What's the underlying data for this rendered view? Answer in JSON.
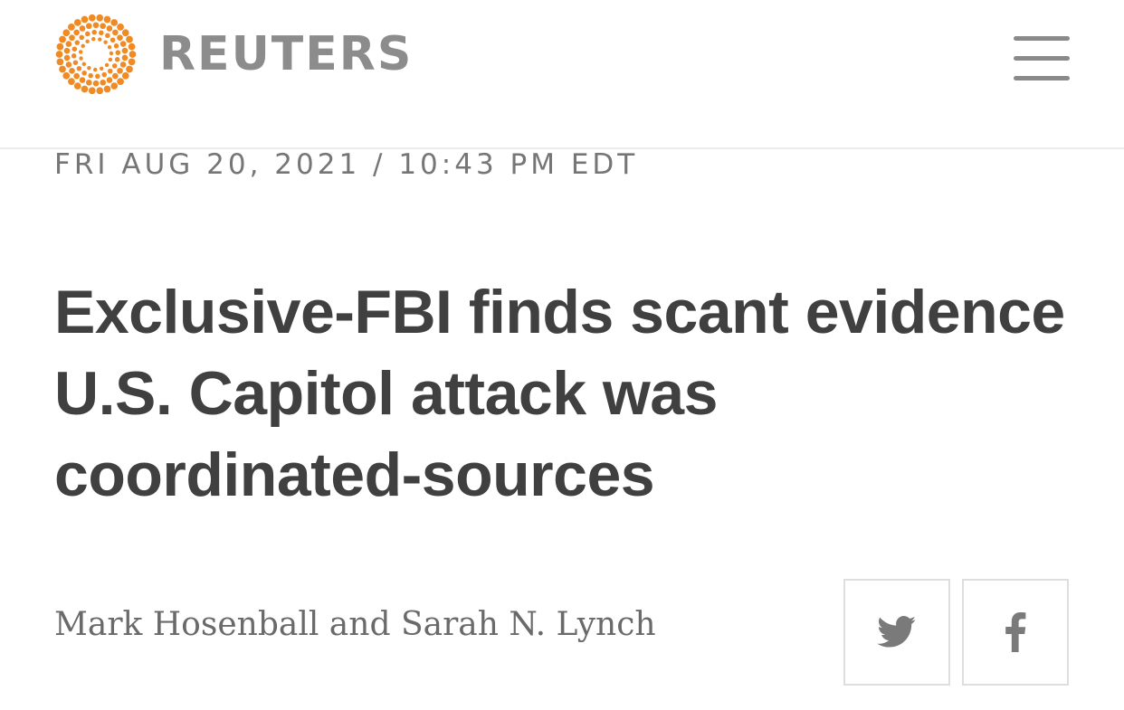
{
  "header": {
    "logo_text": "REUTERS",
    "logo_icon": "reuters-dot-logo",
    "brand_color": "#F08A24",
    "menu_icon": "hamburger-menu-icon"
  },
  "article": {
    "dateline": "FRI AUG 20, 2021 / 10:43 PM EDT",
    "headline": "Exclusive-FBI finds scant evidence U.S. Capitol attack was coordinated-sources",
    "byline": "Mark Hosenball and Sarah N. Lynch"
  },
  "share": {
    "twitter_icon": "twitter-icon",
    "facebook_icon": "facebook-icon",
    "icon_color": "#7a7a7a"
  }
}
